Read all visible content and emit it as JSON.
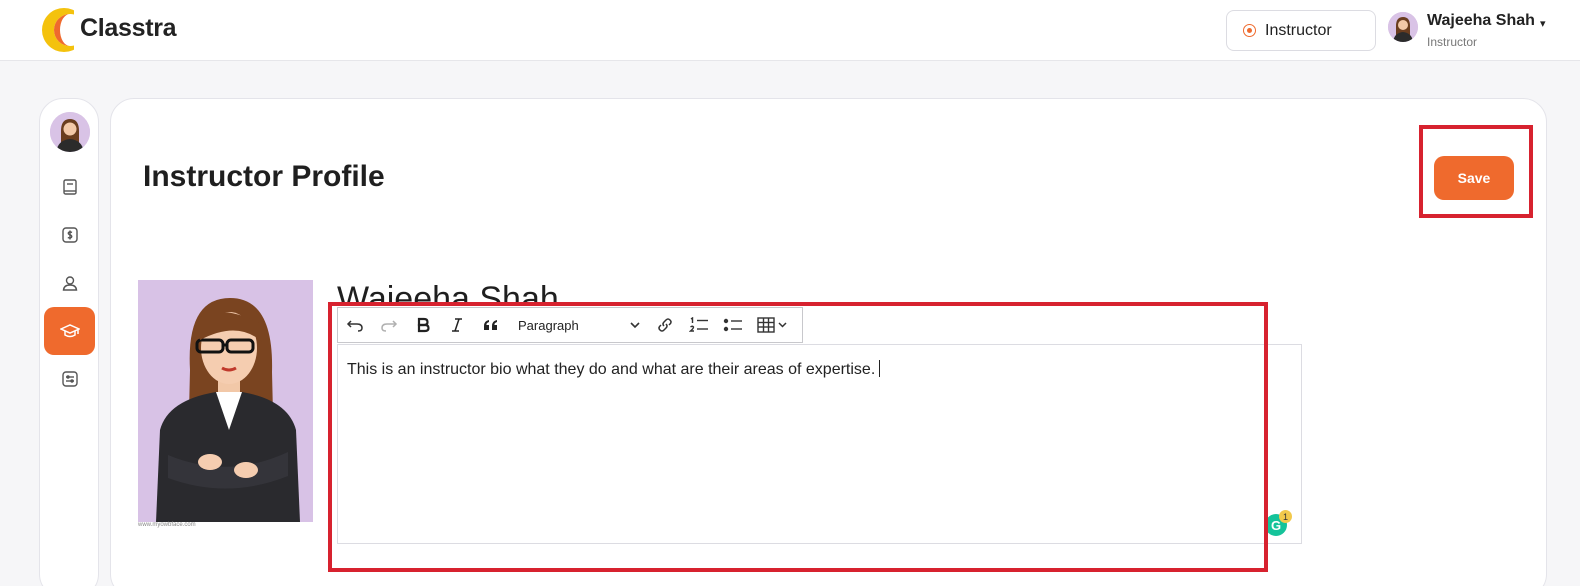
{
  "brand": {
    "name": "Classtra",
    "logo_icon": "classtra-logo-icon",
    "accent": "#ef6a2d"
  },
  "header": {
    "role_switch": {
      "label": "Instructor",
      "icon": "radio-selected-icon"
    },
    "user": {
      "name": "Wajeeha Shah",
      "role": "Instructor",
      "caret": "▾"
    }
  },
  "sidebar": {
    "items": [
      {
        "name": "book",
        "icon": "book-icon",
        "active": false
      },
      {
        "name": "payments",
        "icon": "dollar-icon",
        "active": false
      },
      {
        "name": "students",
        "icon": "user-icon",
        "active": false
      },
      {
        "name": "instructor-profile",
        "icon": "graduation-cap-icon",
        "active": true
      },
      {
        "name": "settings",
        "icon": "sliders-icon",
        "active": false
      }
    ]
  },
  "page": {
    "title": "Instructor Profile",
    "save_label": "Save",
    "photo_caption": "www.myowbface.com",
    "name": "Wajeeha Shah"
  },
  "editor": {
    "block_format": "Paragraph",
    "content": "This is an instructor bio what they do and what are their areas of expertise.",
    "toolbar_icons": [
      "undo-icon",
      "redo-icon",
      "bold-icon",
      "italic-icon",
      "blockquote-icon",
      "link-icon",
      "numbered-list-icon",
      "bulleted-list-icon",
      "table-icon"
    ]
  },
  "grammarly": {
    "label": "G",
    "count": "1",
    "color": "#15c39a"
  },
  "highlight_color": "#d7222f"
}
